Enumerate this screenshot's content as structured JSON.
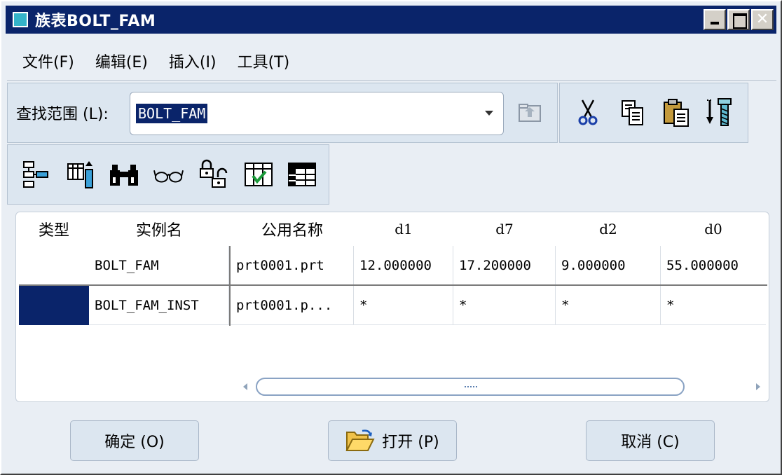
{
  "window": {
    "title": "族表BOLT_FAM"
  },
  "menu": [
    "文件(F)",
    "编辑(E)",
    "插入(I)",
    "工具(T)"
  ],
  "lookin": {
    "label": "查找范围 (L):",
    "value": "BOLT_FAM"
  },
  "table": {
    "headers": [
      "类型",
      "实例名",
      "公用名称",
      "d1",
      "d7",
      "d2",
      "d0"
    ],
    "rows": [
      {
        "name": "BOLT_FAM",
        "common": "prt0001.prt",
        "d1": "12.000000",
        "d7": "17.200000",
        "d2": "9.000000",
        "d0": "55.000000"
      },
      {
        "name": "BOLT_FAM_INST",
        "common": "prt0001.p...",
        "d1": "*",
        "d7": "*",
        "d2": "*",
        "d0": "*"
      }
    ]
  },
  "buttons": {
    "ok": "确定 (O)",
    "open": "打开 (P)",
    "cancel": "取消 (C)"
  },
  "colors": {
    "titlebar": "#0a246a",
    "selection": "#0a246a"
  }
}
